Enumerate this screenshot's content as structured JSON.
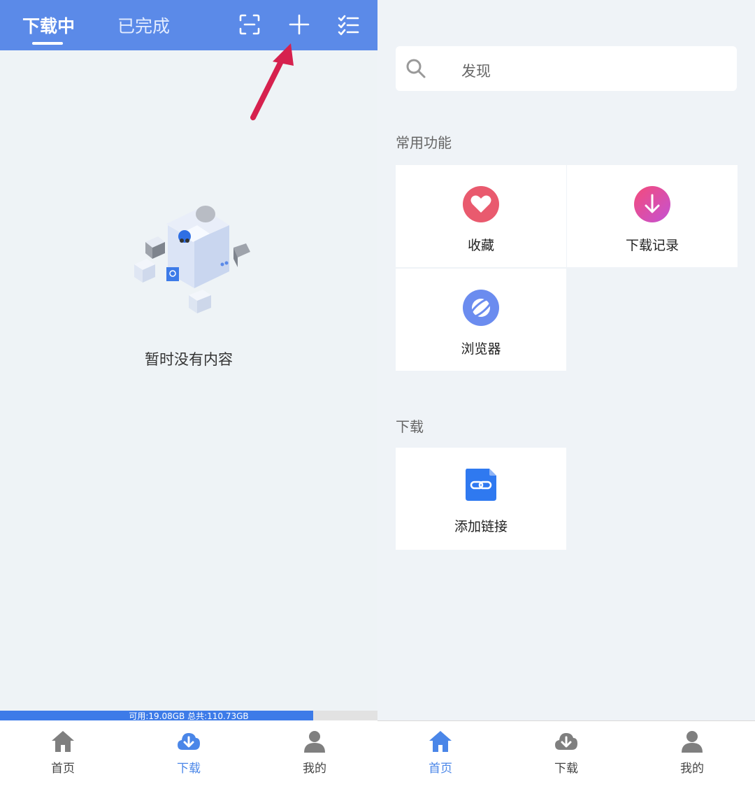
{
  "left": {
    "tabs": [
      {
        "label": "下载中",
        "active": true
      },
      {
        "label": "已完成",
        "active": false
      }
    ],
    "empty_text": "暂时没有内容",
    "storage": {
      "text": "可用:19.08GB 总共:110.73GB",
      "used_fraction": 0.83
    }
  },
  "right": {
    "search": {
      "placeholder": "发现"
    },
    "sections": {
      "common_title": "常用功能",
      "download_title": "下载"
    },
    "cards": [
      {
        "label": "收藏",
        "icon": "heart-icon"
      },
      {
        "label": "下载记录",
        "icon": "download-arrow-icon"
      },
      {
        "label": "浏览器",
        "icon": "planet-browser-icon"
      },
      {
        "label": "添加链接",
        "icon": "link-document-icon"
      }
    ]
  },
  "bottom_nav": [
    {
      "label": "首页",
      "icon": "home-icon"
    },
    {
      "label": "下载",
      "icon": "cloud-download-icon"
    },
    {
      "label": "我的",
      "icon": "person-icon"
    }
  ],
  "colors": {
    "header": "#5b8ae8",
    "accent": "#4a86e8",
    "heart": "#e95a6e",
    "download_gradient_start": "#f44b7a",
    "download_gradient_end": "#c452d4",
    "browser": "#6b8cef",
    "link": "#2f79f0",
    "annotation_arrow": "#d6214e"
  }
}
